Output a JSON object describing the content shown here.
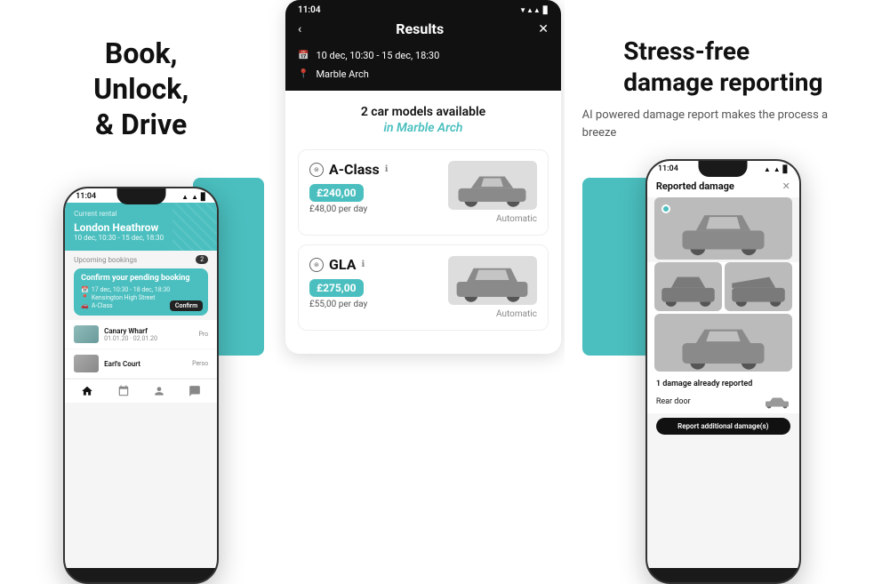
{
  "left": {
    "headline": "Book,\nUnlock,\n& Drive",
    "phone": {
      "time": "11:04",
      "current_rental_label": "Current rental",
      "rental_title": "London Heathrow",
      "rental_dates": "10 dec, 10:30 - 15 dec, 18:30",
      "upcoming_label": "Upcoming bookings",
      "upcoming_count": "2",
      "booking_title": "Confirm your pending booking",
      "booking_date": "17 dec, 10:30 - 18 dec, 18:30",
      "booking_location": "Kensington High Street",
      "booking_car": "A-Class",
      "confirm_label": "Confirm",
      "listing1_name": "Canary Wharf",
      "listing1_date": "01.01.20 · 02.01.20",
      "listing1_meta": "Pro",
      "listing2_name": "Earl's Court",
      "listing2_meta": "Perso"
    }
  },
  "middle": {
    "dark_header": {
      "time": "11:04",
      "title": "Results",
      "back_label": "‹",
      "close_label": "✕",
      "date_range": "10 dec, 10:30 - 15 dec, 18:30",
      "location": "Marble Arch"
    },
    "available_text": "2 car models available",
    "available_location": "in Marble Arch",
    "cars": [
      {
        "model": "A-Class",
        "price": "£240,00",
        "per_day": "£48,00 per day",
        "transmission": "Automatic"
      },
      {
        "model": "GLA",
        "price": "£275,00",
        "per_day": "£55,00 per day",
        "transmission": "Automatic"
      }
    ]
  },
  "right": {
    "headline": "Stress-free\ndamage reporting",
    "subheadline": "AI powered damage report makes the process a breeze",
    "phone": {
      "time": "11:04",
      "reported_title": "Reported damage",
      "damage_count": "1 damage already reported",
      "rear_door_label": "Rear door",
      "report_btn_label": "Report additional damage(s)"
    }
  }
}
